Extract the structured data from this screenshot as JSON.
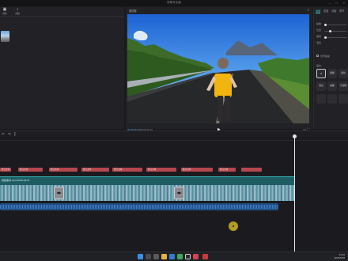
{
  "window": {
    "title": "剪映专业版"
  },
  "media_panel": {
    "tabs": [
      {
        "label": "媒体",
        "icon": "media-icon"
      },
      {
        "label": "音频",
        "icon": "music-icon"
      }
    ]
  },
  "player": {
    "title": "播放器",
    "timecode": "00:00:05:15",
    "duration": "00:00:32:13",
    "ratio": "适应"
  },
  "inspector": {
    "tabs": [
      "画面",
      "变速",
      "动画",
      "调节"
    ],
    "rows": [
      "缩放",
      "位置",
      "旋转",
      "混合"
    ],
    "background_label": "背景填充",
    "canvas_label": "画布",
    "boxes": [
      "无",
      "模糊",
      "颜色",
      "样式",
      "模糊",
      "不透明"
    ]
  },
  "timeline": {
    "tools": [
      "undo-icon",
      "redo-icon",
      "split-icon"
    ],
    "subtitles": [
      {
        "label": "默认文本"
      },
      {
        "label": "默认文本"
      },
      {
        "label": "默认文本"
      },
      {
        "label": "默认文本"
      },
      {
        "label": "默认文本"
      },
      {
        "label": "默认文本"
      },
      {
        "label": "默认文本"
      },
      {
        "label": "默认文本"
      }
    ],
    "video_track_label": "视频素材.mp4  00:00:32:13",
    "markers": [
      "◀▶",
      "◀▶"
    ]
  },
  "taskbar": {
    "time": "14:32",
    "date": "2023/5/18"
  },
  "colors": {
    "accent": "#3fc1c9",
    "subtitle_clip": "#b5474f",
    "video_track": "#1e5e63",
    "audio_track": "#1f4f86",
    "cursor_highlight": "#e6c828"
  }
}
